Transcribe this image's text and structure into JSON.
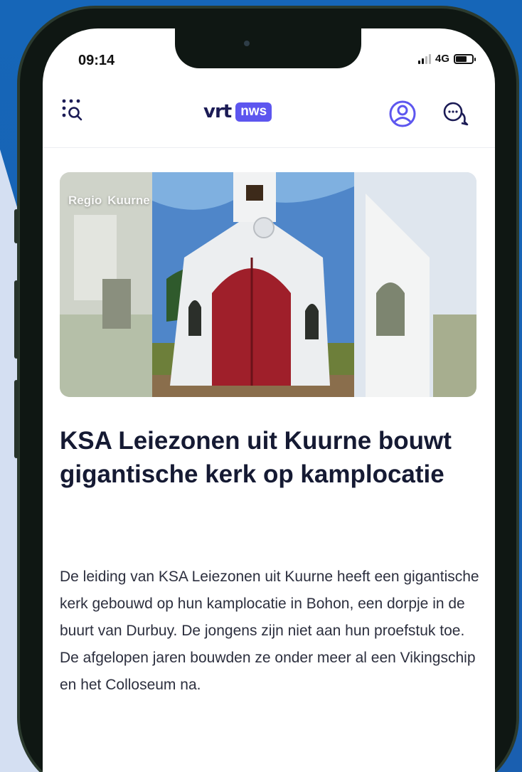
{
  "status_bar": {
    "time": "09:14",
    "network": "4G",
    "icons": [
      "signal-icon",
      "battery-icon"
    ]
  },
  "app_bar": {
    "logo_left": "vrt",
    "logo_right": "nws",
    "icons": [
      "menu-search-icon",
      "profile-icon",
      "chat-icon"
    ],
    "colors": {
      "accent": "#5d56ef",
      "logo_text": "#1b1b55"
    }
  },
  "article": {
    "tags": [
      "Regio",
      "Kuurne"
    ],
    "headline": "KSA Leiezonen uit Kuurne bouwt gigantische kerk op kamplocatie",
    "lead": "De leiding van KSA Leiezonen uit Kuurne heeft een gigantische kerk gebouwd op hun kamplocatie in Bohon, een dorpje in de buurt van Durbuy. De jongens zijn niet aan hun proefstuk toe. De afgelopen jaren bouwden ze onder meer al een Vikingschip en het Colloseum na."
  }
}
